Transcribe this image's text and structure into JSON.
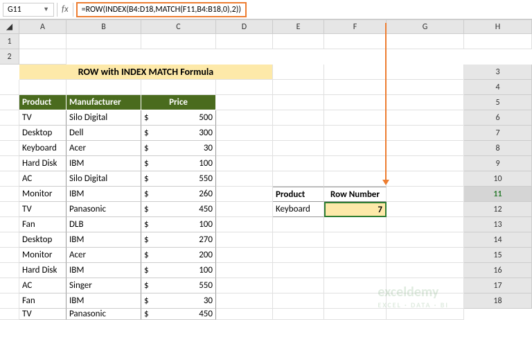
{
  "nameBox": "G11",
  "fxLabel": "fx",
  "formula": "=ROW(INDEX(B4:D18,MATCH(F11,B4:B18,0),2))",
  "title": "ROW with INDEX MATCH Formula",
  "columns": [
    "A",
    "B",
    "C",
    "D",
    "E",
    "F",
    "G",
    "H"
  ],
  "headers": {
    "product": "Product",
    "manufacturer": "Manufacturer",
    "price": "Price"
  },
  "rows": [
    {
      "product": "TV",
      "manufacturer": "Silo Digital",
      "price": "500"
    },
    {
      "product": "Desktop",
      "manufacturer": "Dell",
      "price": "300"
    },
    {
      "product": "Keyboard",
      "manufacturer": "Acer",
      "price": "30"
    },
    {
      "product": "Hard Disk",
      "manufacturer": "IBM",
      "price": "100"
    },
    {
      "product": "AC",
      "manufacturer": "Silo Digital",
      "price": "550"
    },
    {
      "product": "Monitor",
      "manufacturer": "IBM",
      "price": "260"
    },
    {
      "product": "TV",
      "manufacturer": "Panasonic",
      "price": "450"
    },
    {
      "product": "Fan",
      "manufacturer": "DLB",
      "price": "100"
    },
    {
      "product": "Desktop",
      "manufacturer": "IBM",
      "price": "270"
    },
    {
      "product": "Monitor",
      "manufacturer": "Acer",
      "price": "200"
    },
    {
      "product": "Hard Disk",
      "manufacturer": "IBM",
      "price": "100"
    },
    {
      "product": "AC",
      "manufacturer": "Singer",
      "price": "550"
    },
    {
      "product": "Fan",
      "manufacturer": "IBM",
      "price": "30"
    },
    {
      "product": "TV",
      "manufacturer": "Panasonic",
      "price": "450"
    }
  ],
  "currency": "$",
  "lookup": {
    "header1": "Product",
    "header2": "Row Number",
    "value": "Keyboard",
    "result": "7"
  },
  "watermark": {
    "main": "exceldemy",
    "sub": "EXCEL · DATA · BI"
  }
}
